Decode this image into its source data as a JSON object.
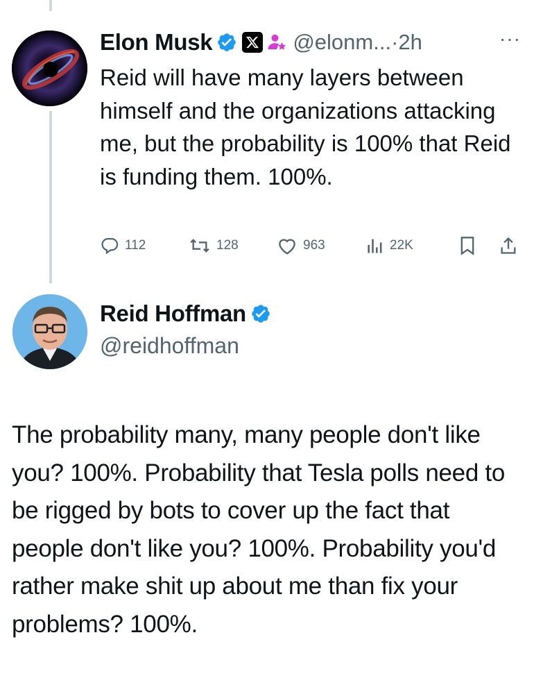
{
  "tweet_original": {
    "author_name": "Elon Musk",
    "handle": "@elonm...",
    "time_sep": "·",
    "time": "2h",
    "more_label": "···",
    "text": "Reid will have many layers between himself and the organizations attacking me, but the probability is 100% that Reid is funding them. 100%.",
    "actions": {
      "replies": "112",
      "reposts": "128",
      "likes": "963",
      "views": "22K"
    }
  },
  "tweet_reply": {
    "author_name": "Reid Hoffman",
    "handle": "@reidhoffman",
    "text": "The probability many, many people don't like you? 100%. Probability that Tesla polls need to be rigged by bots to cover up the fact that people don't like you? 100%. Probability you'd rather make shit up about me than fix your problems? 100%."
  },
  "colors": {
    "verified_blue": "#1d9bf0",
    "secondary_text": "#536471",
    "affiliate_pink": "#d63bd6",
    "thread_line": "#cfd9de"
  },
  "icons": [
    "verified-badge-icon",
    "x-logo-icon",
    "affiliate-icon",
    "reply-icon",
    "repost-icon",
    "like-icon",
    "views-icon",
    "bookmark-icon",
    "share-icon"
  ]
}
